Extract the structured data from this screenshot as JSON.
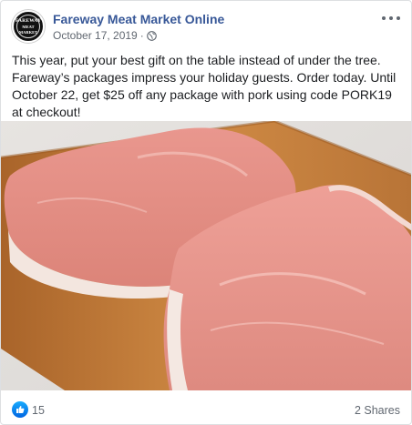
{
  "post": {
    "page_name": "Fareway Meat Market Online",
    "date": "October 17, 2019",
    "separator": "·",
    "privacy_icon": "globe-icon",
    "avatar_logo_lines": [
      "FAREWAY",
      "MEAT",
      "MARKET"
    ],
    "caption": "This year, put your best gift on the table instead of under the tree. Fareway’s packages impress your holiday guests. Order today. Until October 22, get $25 off any package with pork using code PORK19 at checkout!",
    "image_description_icon": "pork-chops-photo",
    "reactions": {
      "icon": "like-icon",
      "count": "15"
    },
    "shares": "2 Shares"
  },
  "colors": {
    "link": "#385898",
    "meta": "#606770",
    "like_blue": "#1877f2",
    "board": "#c7823e",
    "meat": "#e89b92"
  }
}
